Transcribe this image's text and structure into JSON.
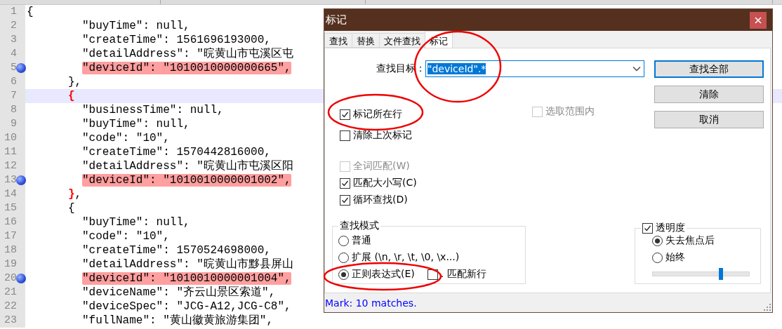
{
  "editor": {
    "lines": [
      {
        "number": "1",
        "kind": "root",
        "brace": "{",
        "matched": false,
        "current": false
      },
      {
        "number": "2",
        "kind": "entry",
        "text": "\"buyTime\": null,",
        "marked": false,
        "bookmark": false
      },
      {
        "number": "3",
        "kind": "entry",
        "text": "\"createTime\": 1561696193000,",
        "marked": false,
        "bookmark": false
      },
      {
        "number": "4",
        "kind": "entry",
        "text": "\"detailAddress\": \"晥黄山市屯溪区屯",
        "marked": false,
        "bookmark": false
      },
      {
        "number": "5",
        "kind": "entry",
        "text": "\"deviceId\": \"1010010000000665\",",
        "marked": true,
        "bookmark": true
      },
      {
        "number": "6",
        "kind": "brace",
        "brace": "}",
        "rest": ",",
        "matched": false,
        "current": false
      },
      {
        "number": "7",
        "kind": "brace",
        "brace": "{",
        "matched": true,
        "current": true
      },
      {
        "number": "8",
        "kind": "entry",
        "text": "\"businessTime\": null,",
        "marked": false,
        "bookmark": false
      },
      {
        "number": "9",
        "kind": "entry",
        "text": "\"buyTime\": null,",
        "marked": false,
        "bookmark": false
      },
      {
        "number": "10",
        "kind": "entry",
        "text": "\"code\": \"10\",",
        "marked": false,
        "bookmark": false
      },
      {
        "number": "11",
        "kind": "entry",
        "text": "\"createTime\": 1570442816000,",
        "marked": false,
        "bookmark": false
      },
      {
        "number": "12",
        "kind": "entry",
        "text": "\"detailAddress\": \"晥黄山市屯溪区阳",
        "marked": false,
        "bookmark": false
      },
      {
        "number": "13",
        "kind": "entry",
        "text": "\"deviceId\": \"1010010000001002\",",
        "marked": true,
        "bookmark": true
      },
      {
        "number": "14",
        "kind": "brace",
        "brace": "}",
        "rest": ",",
        "matched": true,
        "current": false
      },
      {
        "number": "15",
        "kind": "brace",
        "brace": "{",
        "matched": false,
        "current": false
      },
      {
        "number": "16",
        "kind": "entry",
        "text": "\"buyTime\": null,",
        "marked": false,
        "bookmark": false
      },
      {
        "number": "17",
        "kind": "entry",
        "text": "\"code\": \"10\",",
        "marked": false,
        "bookmark": false
      },
      {
        "number": "18",
        "kind": "entry",
        "text": "\"createTime\": 1570524698000,",
        "marked": false,
        "bookmark": false
      },
      {
        "number": "19",
        "kind": "entry",
        "text": "\"detailAddress\": \"晥黄山市黟县屏山",
        "marked": false,
        "bookmark": false
      },
      {
        "number": "20",
        "kind": "entry",
        "text": "\"deviceId\": \"1010010000001004\",",
        "marked": true,
        "bookmark": true
      },
      {
        "number": "21",
        "kind": "entry",
        "text": "\"deviceName\": \"齐云山景区索道\",",
        "marked": false,
        "bookmark": false
      },
      {
        "number": "22",
        "kind": "entry",
        "text": "\"deviceSpec\": \"JCG-A12,JCG-C8\",",
        "marked": false,
        "bookmark": false
      },
      {
        "number": "23",
        "kind": "entry",
        "text": "\"fullName\": \"黄山徽黄旅游集团\",",
        "marked": false,
        "bookmark": false
      }
    ]
  },
  "dialog": {
    "title": "标记",
    "tabs": [
      {
        "label": "查找",
        "selected": false
      },
      {
        "label": "替换",
        "selected": false
      },
      {
        "label": "文件查找",
        "selected": false
      },
      {
        "label": "标记",
        "selected": true
      }
    ],
    "target": {
      "label": "查找目标：",
      "value": "\"deviceId\".*",
      "selected": true
    },
    "buttons": [
      {
        "label": "查找全部",
        "default": true
      },
      {
        "label": "清除",
        "default": false
      },
      {
        "label": "取消",
        "default": false
      }
    ],
    "mark_options": [
      {
        "label": "标记所在行",
        "checked": true,
        "disabled": false
      },
      {
        "label": "清除上次标记",
        "checked": false,
        "disabled": false
      }
    ],
    "in_selection": {
      "label": "选取范围内",
      "checked": false,
      "disabled": true
    },
    "match_options": [
      {
        "label": "全词匹配(W)",
        "checked": false,
        "disabled": true
      },
      {
        "label": "匹配大小写(C)",
        "checked": true,
        "disabled": false
      },
      {
        "label": "循环查找(D)",
        "checked": true,
        "disabled": false
      }
    ],
    "search_mode": {
      "title": "查找模式",
      "modes": [
        {
          "label": "普通",
          "selected": false
        },
        {
          "label": "扩展 (\\n, \\r, \\t, \\0, \\x...)",
          "selected": false
        },
        {
          "label": "正则表达式(E)",
          "selected": true
        }
      ],
      "dot_newline": {
        "label": ". 匹配新行",
        "checked": false,
        "disabled": false
      }
    },
    "transparency": {
      "label": "透明度",
      "checked": true,
      "modes": [
        {
          "label": "失去焦点后",
          "selected": true
        },
        {
          "label": "始终",
          "selected": false
        }
      ],
      "level": 0.71
    },
    "status": "Mark: 10 matches."
  }
}
